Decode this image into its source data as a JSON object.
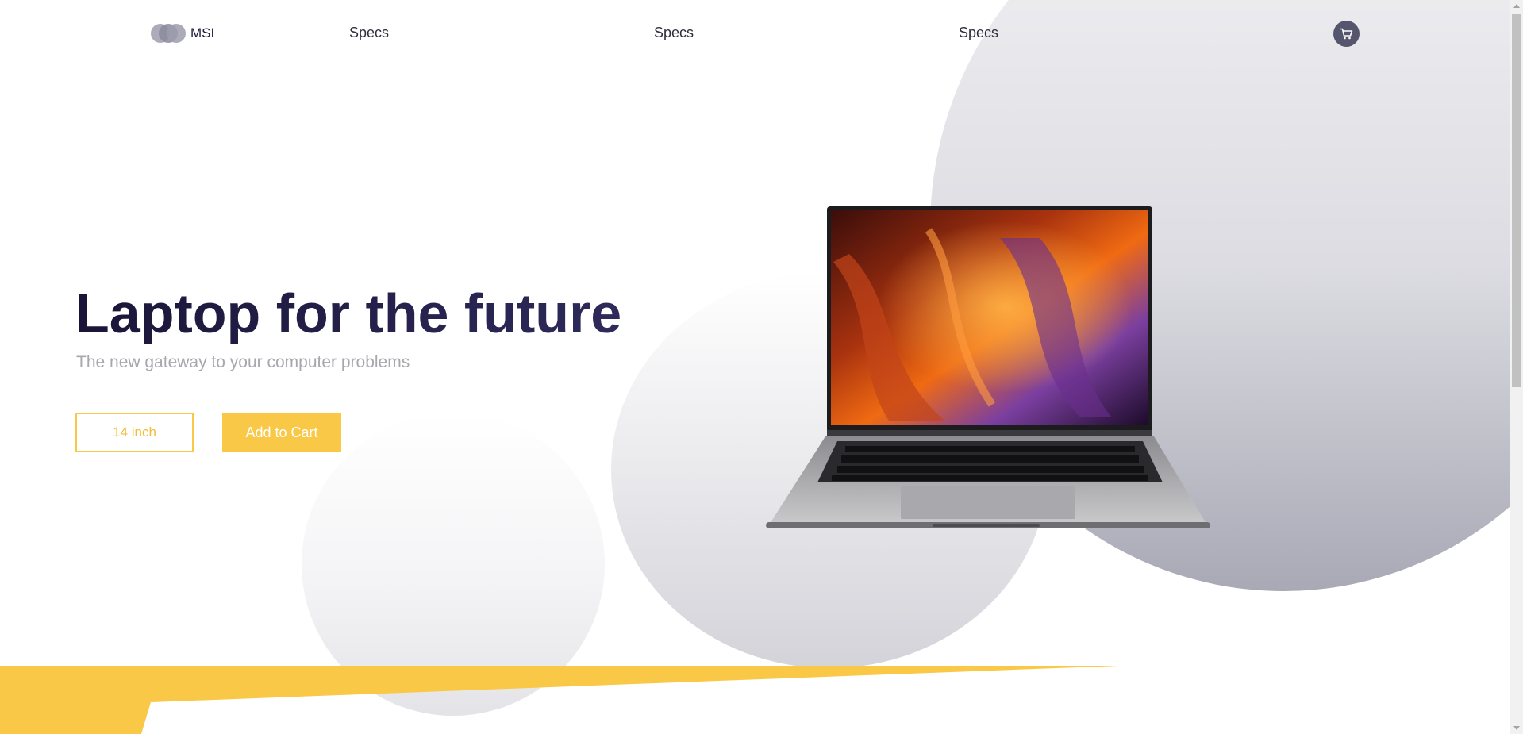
{
  "nav": {
    "brand": "MSI",
    "links": [
      "Specs",
      "Specs",
      "Specs"
    ],
    "cart_icon": "cart-icon"
  },
  "hero": {
    "title": "Laptop for the future",
    "subtitle": "The new gateway to your computer problems",
    "size_button": "14 inch",
    "cart_button": "Add to Cart"
  },
  "colors": {
    "accent": "#f9c846",
    "title": "#1a1538",
    "subtitle": "#a7a7ae",
    "cart_badge": "#55556d"
  }
}
